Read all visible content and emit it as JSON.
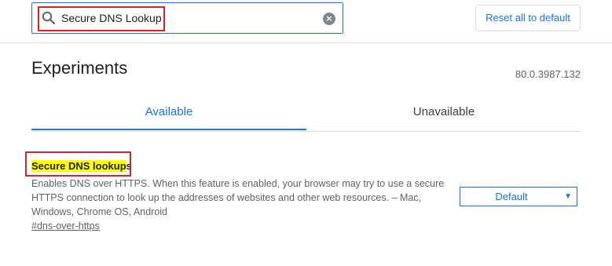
{
  "search": {
    "value": "Secure DNS Lookup",
    "icon": "search-icon",
    "clear_icon": "clear-icon"
  },
  "header": {
    "reset_label": "Reset all to default"
  },
  "page": {
    "title": "Experiments",
    "version": "80.0.3987.132"
  },
  "tabs": [
    {
      "label": "Available",
      "selected": true
    },
    {
      "label": "Unavailable",
      "selected": false
    }
  ],
  "experiment": {
    "name_highlight": "Secure DNS lookup",
    "name_rest": "s",
    "description": "Enables DNS over HTTPS. When this feature is enabled, your browser may try to use a secure HTTPS connection to look up the addresses of websites and other web resources. – Mac, Windows, Chrome OS, Android",
    "link": "#dns-over-https",
    "select_value": "Default"
  },
  "colors": {
    "accent": "#1a73e8",
    "highlight": "#ffff00",
    "annotation": "#d3232b"
  }
}
